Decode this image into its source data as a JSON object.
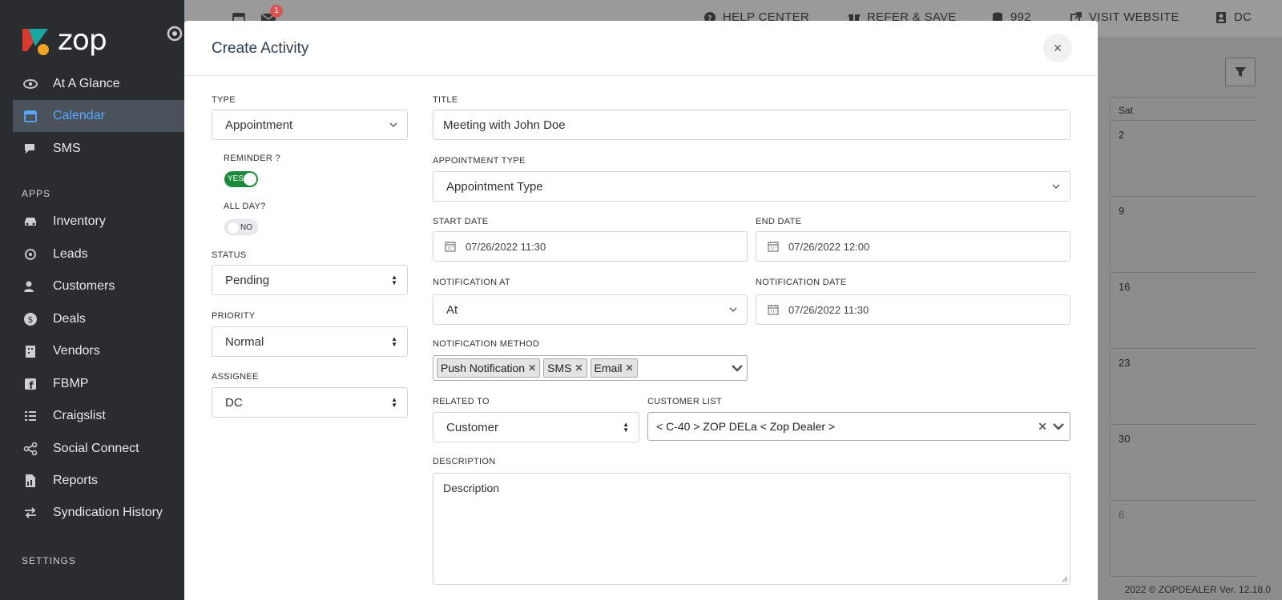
{
  "sidebar": {
    "logo_text": "zop",
    "items_main": [
      {
        "label": "At A Glance",
        "icon": "eye-icon"
      },
      {
        "label": "Calendar",
        "icon": "calendar-icon",
        "active": true
      },
      {
        "label": "SMS",
        "icon": "chat-icon"
      }
    ],
    "apps_heading": "APPS",
    "items_apps": [
      {
        "label": "Inventory",
        "icon": "car-icon"
      },
      {
        "label": "Leads",
        "icon": "target-icon"
      },
      {
        "label": "Customers",
        "icon": "users-icon"
      },
      {
        "label": "Deals",
        "icon": "dollar-icon"
      },
      {
        "label": "Vendors",
        "icon": "building-icon"
      },
      {
        "label": "FBMP",
        "icon": "facebook-icon"
      },
      {
        "label": "Craigslist",
        "icon": "list-icon"
      },
      {
        "label": "Social Connect",
        "icon": "share-icon"
      },
      {
        "label": "Reports",
        "icon": "report-icon"
      },
      {
        "label": "Syndication History",
        "icon": "swap-icon"
      }
    ],
    "settings_heading": "SETTINGS"
  },
  "topbar": {
    "notification_count": "1",
    "help_center": "HELP CENTER",
    "refer_save": "REFER & SAVE",
    "credits": "992",
    "visit_website": "VISIT WEBSITE",
    "user": "DC"
  },
  "calendar_bg": {
    "sat_header": "Sat",
    "days": [
      "2",
      "9",
      "16",
      "23",
      "30",
      "6"
    ]
  },
  "footer": "2022 © ZOPDEALER Ver. 12.18.0",
  "modal": {
    "title": "Create Activity",
    "close_label": "×",
    "type": {
      "label": "TYPE",
      "value": "Appointment"
    },
    "reminder": {
      "label": "REMINDER ?",
      "state": "YES"
    },
    "all_day": {
      "label": "ALL DAY?",
      "state": "NO"
    },
    "status": {
      "label": "STATUS",
      "value": "Pending"
    },
    "priority": {
      "label": "PRIORITY",
      "value": "Normal"
    },
    "assignee": {
      "label": "ASSIGNEE",
      "value": "DC"
    },
    "title_field": {
      "label": "TITLE",
      "value": "Meeting with John Doe"
    },
    "appointment_type": {
      "label": "APPOINTMENT TYPE",
      "value": "Appointment Type"
    },
    "start_date": {
      "label": "START DATE",
      "value": "07/26/2022 11:30"
    },
    "end_date": {
      "label": "END DATE",
      "value": "07/26/2022 12:00"
    },
    "notification_at": {
      "label": "NOTIFICATION AT",
      "value": "At"
    },
    "notification_date": {
      "label": "NOTIFICATION DATE",
      "value": "07/26/2022 11:30"
    },
    "notification_method": {
      "label": "NOTIFICATION METHOD",
      "tags": [
        "Push Notification",
        "SMS",
        "Email"
      ]
    },
    "related_to": {
      "label": "RELATED TO",
      "value": "Customer"
    },
    "customer_list": {
      "label": "CUSTOMER LIST",
      "value": "< C-40 > ZOP DELa < Zop Dealer >"
    },
    "description": {
      "label": "DESCRIPTION",
      "placeholder": "Description"
    }
  }
}
